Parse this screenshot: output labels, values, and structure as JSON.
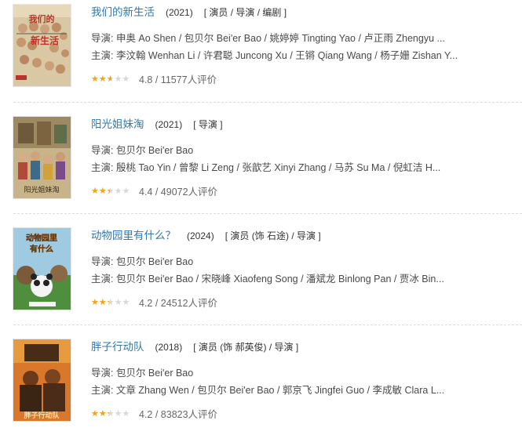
{
  "movies": [
    {
      "title": "我们的新生活",
      "year": "(2021)",
      "roles": "[ 演员 / 导演 / 编剧 ]",
      "directors": "导演: 申奥 Ao Shen / 包贝尔 Bei'er Bao / 姚婷婷 Tingting Yao / 卢正雨 Zhengyu ...",
      "cast": "主演: 李汶翰 Wenhan Li / 许君聪 Juncong Xu / 王锵 Qiang Wang / 杨子姗 Zishan Y...",
      "rating": 4.8,
      "rating_text": "4.8 / 11577人评价",
      "poster_colors": [
        "#d7c7a6",
        "#b8342a",
        "#2f2a25"
      ],
      "poster_text": "我们的新生活"
    },
    {
      "title": "阳光姐妹淘",
      "year": "(2021)",
      "roles": "[ 导演 ]",
      "directors": "导演: 包贝尔 Bei'er Bao",
      "cast": "主演: 殷桃 Tao Yin / 曾黎 Li Zeng / 张歆艺 Xinyi Zhang / 马苏 Su Ma / 倪虹洁 H...",
      "rating": 4.4,
      "rating_text": "4.4 / 49072人评价",
      "poster_colors": [
        "#c6b48a",
        "#8e6a45",
        "#4f6c48"
      ],
      "poster_text": "阳光姐妹淘"
    },
    {
      "title": "动物园里有什么？",
      "year": "(2024)",
      "roles": "[ 演员 (饰 石途) / 导演 ]",
      "directors": "导演: 包贝尔 Bei'er Bao",
      "cast": "主演: 包贝尔 Bei'er Bao / 宋晓峰 Xiaofeng Song / 潘斌龙 Binlong Pan / 贾冰 Bin...",
      "rating": 4.2,
      "rating_text": "4.2 / 24512人评价",
      "poster_colors": [
        "#8fc1dc",
        "#4a8a3a",
        "#e8c33a"
      ],
      "poster_text": "动物园里有什么"
    },
    {
      "title": "胖子行动队",
      "year": "(2018)",
      "roles": "[ 演员 (饰 郝英俊) / 导演 ]",
      "directors": "导演: 包贝尔 Bei'er Bao",
      "cast": "主演: 文章 Zhang Wen / 包贝尔 Bei'er Bao / 郭京飞 Jingfei Guo / 李成敏 Clara L...",
      "rating": 4.2,
      "rating_text": "4.2 / 83823人评价",
      "poster_colors": [
        "#d9782a",
        "#7a3a12",
        "#2a1a10"
      ],
      "poster_text": "胖子行动队"
    }
  ],
  "star_glyphs": "★★★★★"
}
